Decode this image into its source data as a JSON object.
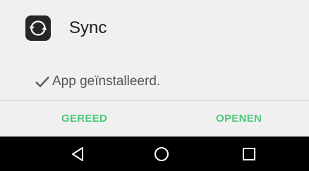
{
  "app": {
    "name": "Sync",
    "icon": "sync-icon"
  },
  "status": {
    "icon": "check-icon",
    "text": "App geïnstalleerd."
  },
  "actions": {
    "done_label": "GEREED",
    "open_label": "OPENEN"
  },
  "navbar": {
    "back_icon": "back-triangle-icon",
    "home_icon": "home-circle-icon",
    "recent_icon": "recent-apps-square-icon"
  },
  "colors": {
    "accent": "#4dc97b",
    "background": "#f0f0f0",
    "navbar": "#000000",
    "app_icon_bg": "#262626"
  }
}
